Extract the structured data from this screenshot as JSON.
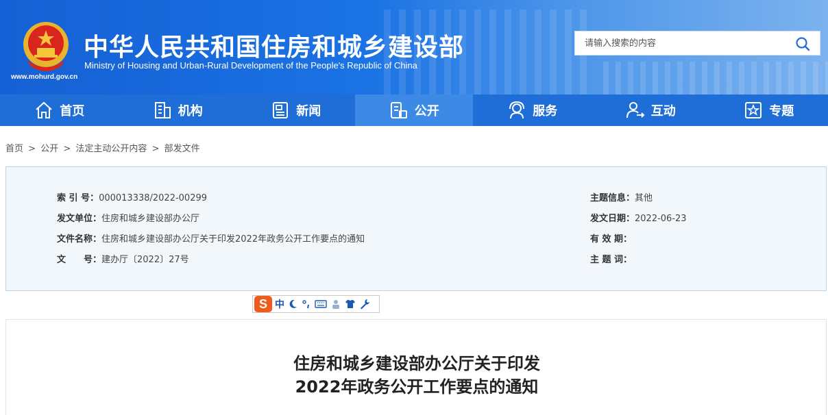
{
  "header": {
    "title": "中华人民共和国住房和城乡建设部",
    "subtitle": "Ministry of Housing and Urban-Rural Development of the People's Republic of China",
    "url": "www.mohurd.gov.cn",
    "search_placeholder": "请输入搜索的内容"
  },
  "nav": {
    "items": [
      {
        "label": "首页",
        "icon": "home-icon"
      },
      {
        "label": "机构",
        "icon": "building-icon"
      },
      {
        "label": "新闻",
        "icon": "news-icon"
      },
      {
        "label": "公开",
        "icon": "disclosure-icon",
        "active": true
      },
      {
        "label": "服务",
        "icon": "service-icon"
      },
      {
        "label": "互动",
        "icon": "interaction-icon"
      },
      {
        "label": "专题",
        "icon": "topic-star-icon"
      }
    ]
  },
  "breadcrumb": [
    "首页",
    ">",
    "公开",
    ">",
    "法定主动公开内容",
    ">",
    "部发文件"
  ],
  "info": {
    "index_label": "索 引 号：",
    "index_value": "000013338/2022-00299",
    "issuer_label": "发文单位：",
    "issuer_value": "住房和城乡建设部办公厅",
    "filename_label": "文件名称：",
    "filename_value": "住房和城乡建设部办公厅关于印发2022年政务公开工作要点的通知",
    "docno_label": "文　　号：",
    "docno_value": "建办厅〔2022〕27号",
    "topic_label": "主题信息：",
    "topic_value": "其他",
    "date_label": "发文日期：",
    "date_value": "2022-06-23",
    "validity_label": "有 效 期：",
    "validity_value": "",
    "keywords_label": "主 题 词：",
    "keywords_value": ""
  },
  "ime": {
    "logo": "S",
    "mode": "中"
  },
  "doc": {
    "title_line1": "住房和城乡建设部办公厅关于印发",
    "title_line2": "2022年政务公开工作要点的通知"
  },
  "colors": {
    "nav": "#1f6ed8",
    "nav_active": "#3c8ae6",
    "info_bg": "#f2f7fc"
  }
}
